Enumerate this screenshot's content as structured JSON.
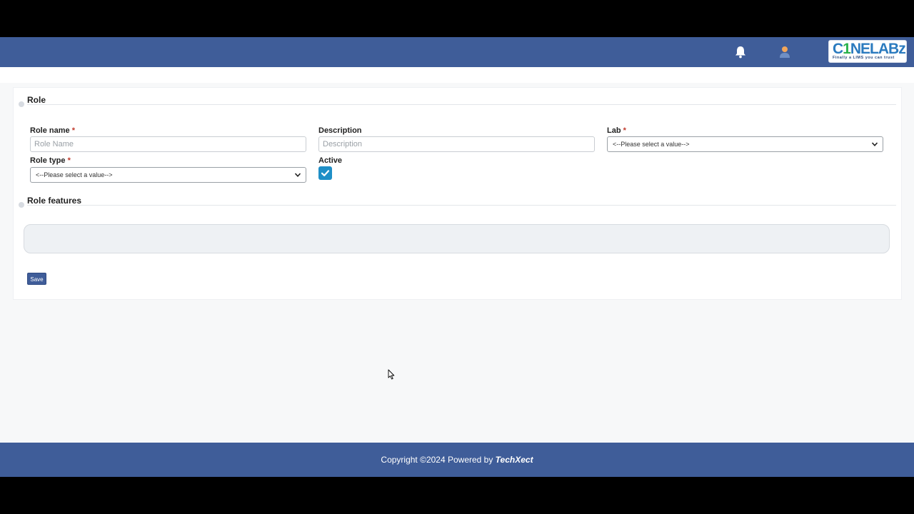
{
  "header": {
    "logo_main_pre": "C",
    "logo_main_o": "1",
    "logo_main_post": "NELABz",
    "logo_tagline": "Finally a LIMS you can trust"
  },
  "sections": {
    "role_title": "Role",
    "features_title": "Role features"
  },
  "form": {
    "role_name_label": "Role name",
    "role_name_placeholder": "Role Name",
    "description_label": "Description",
    "description_placeholder": "Description",
    "lab_label": "Lab",
    "lab_value": "<--Please select a value-->",
    "role_type_label": "Role type",
    "role_type_value": "<--Please select a value-->",
    "active_label": "Active",
    "required_mark": "*",
    "save_label": "Save"
  },
  "footer": {
    "copyright_text": "Copyright ©2024 Powered by ",
    "brand": "TechXect"
  }
}
